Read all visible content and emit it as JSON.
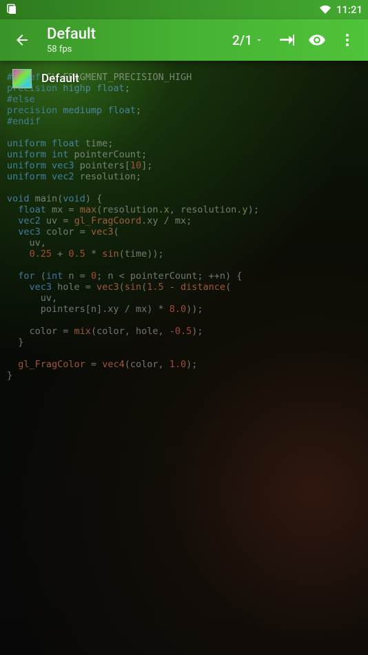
{
  "status": {
    "time": "11:21"
  },
  "appbar": {
    "title": "Default",
    "subtitle": "58 fps",
    "ratio": "2/1"
  },
  "overlay": {
    "label": "Default"
  },
  "code": {
    "l01a": "#ifdef",
    "l01b": " GL_FRAGMENT_PRECISION_HIGH",
    "l02a": "precision ",
    "l02b": "highp",
    "l02c": " float",
    "l02d": ";",
    "l03": "#else",
    "l04a": "precision ",
    "l04b": "mediump",
    "l04c": " float",
    "l04d": ";",
    "l05": "#endif",
    "l06": "",
    "l07a": "uniform ",
    "l07b": "float",
    "l07c": " time;",
    "l08a": "uniform ",
    "l08b": "int",
    "l08c": " pointerCount;",
    "l09a": "uniform ",
    "l09b": "vec3",
    "l09c": " pointers[",
    "l09d": "10",
    "l09e": "];",
    "l10a": "uniform ",
    "l10b": "vec2",
    "l10c": " resolution;",
    "l11": "",
    "l12a": "void",
    "l12b": " main(",
    "l12c": "void",
    "l12d": ") {",
    "l13a": "  float",
    "l13b": " mx = ",
    "l13c": "max",
    "l13d": "(resolution",
    "l13e": ".x",
    "l13f": ", resolution",
    "l13g": ".y",
    "l13h": ");",
    "l14a": "  vec2",
    "l14b": " uv = ",
    "l14c": "gl_FragCoord",
    "l14d": ".xy / mx;",
    "l15a": "  vec3",
    "l15b": " color = ",
    "l15c": "vec3",
    "l15d": "(",
    "l16": "    uv,",
    "l17a": "    ",
    "l17b": "0.25",
    "l17c": " + ",
    "l17d": "0.5",
    "l17e": " * ",
    "l17f": "sin",
    "l17g": "(time));",
    "l19a": "  for",
    "l19b": " (",
    "l19c": "int",
    "l19d": " n = ",
    "l19e": "0",
    "l19f": "; n < pointerCount; ++n) {",
    "l20a": "    vec3",
    "l20b": " hole = ",
    "l20c": "vec3",
    "l20d": "(",
    "l20e": "sin",
    "l20f": "(",
    "l20g": "1.5",
    "l20h": " - ",
    "l20i": "distance",
    "l20j": "(",
    "l21": "      uv,",
    "l22a": "      pointers[n].xy / mx) * ",
    "l22b": "8.0",
    "l22c": "));",
    "l23a": "    color = ",
    "l23b": "mix",
    "l23c": "(color, hole, -",
    "l23d": "0.5",
    "l23e": ");",
    "l24": "  }",
    "l26a": "  gl_FragColor",
    "l26b": " = ",
    "l26c": "vec4",
    "l26d": "(color, ",
    "l26e": "1.0",
    "l26f": ");",
    "l27": "}"
  }
}
